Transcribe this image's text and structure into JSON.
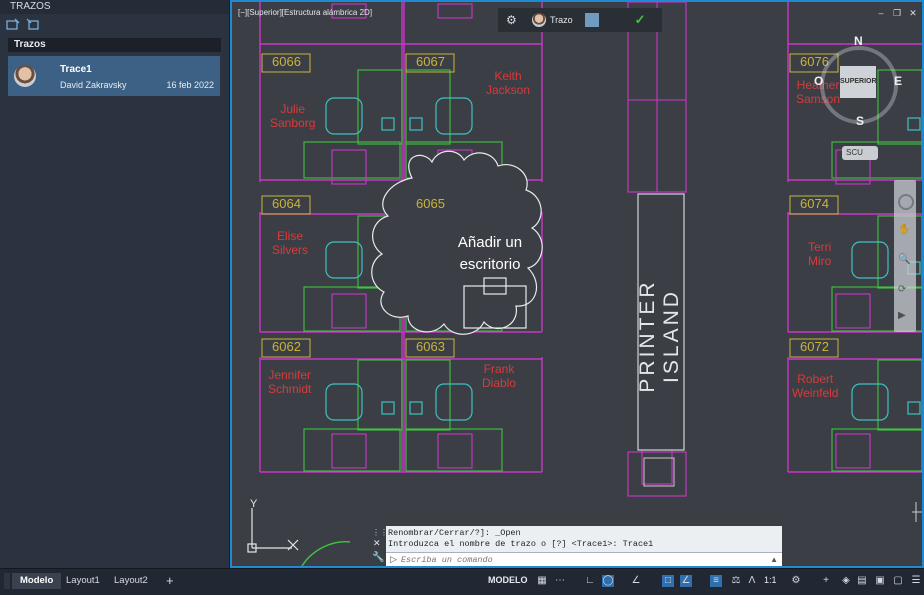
{
  "panel": {
    "title": "TRAZOS",
    "tab": "Trazos",
    "traces": [
      {
        "name": "Trace1",
        "user": "David Zakravsky",
        "date": "16 feb 2022"
      }
    ]
  },
  "viewport": {
    "view_label": "[−][Superior][Estructura alámbrica 2D]",
    "trace_toolbar": {
      "label": "Trazo"
    },
    "viewcube": {
      "north": "N",
      "south": "S",
      "east": "E",
      "west": "O",
      "face": "SUPERIOR",
      "ucs": "SCU"
    },
    "markup": "Añadir un\nescritorio",
    "markup_line1": "Añadir un",
    "markup_line2": "escritorio",
    "printer_island": "PRINTER ISLAND",
    "ucs_y": "Y",
    "desks": [
      "6066",
      "6067",
      "6076",
      "6064",
      "6065",
      "6074",
      "6062",
      "6063",
      "6072"
    ],
    "names": {
      "keith_1": "Keith",
      "keith_2": "Jackson",
      "julie_1": "Julie",
      "julie_2": "Sanborg",
      "heather_1": "Heather",
      "heather_2": "Samson",
      "elise_1": "Elise",
      "elise_2": "Silvers",
      "terri_1": "Terri",
      "terri_2": "Miro",
      "jennifer_1": "Jennifer",
      "jennifer_2": "Schmidt",
      "frank_1": "Frank",
      "frank_2": "Diablo",
      "robert_1": "Robert",
      "robert_2": "Weinfeld"
    }
  },
  "command": {
    "history": [
      "Renombrar/Cerrar/?]: _Open",
      "Introduzca el nombre de trazo o [?] <Trace1>: Trace1"
    ],
    "placeholder": "Escriba un comando"
  },
  "status": {
    "tabs": [
      "Modelo",
      "Layout1",
      "Layout2"
    ],
    "add_tab": "+",
    "mode": "MODELO",
    "scale": "1:1"
  },
  "colors": {
    "accent": "#1f8ad1",
    "canvas_bg": "#3b3f45",
    "walls": "#c837c8",
    "furniture": "#3ec43e",
    "chairs": "#3ec1c1",
    "labels": "#d93a3a",
    "desk_numbers": "#c8b43c"
  }
}
